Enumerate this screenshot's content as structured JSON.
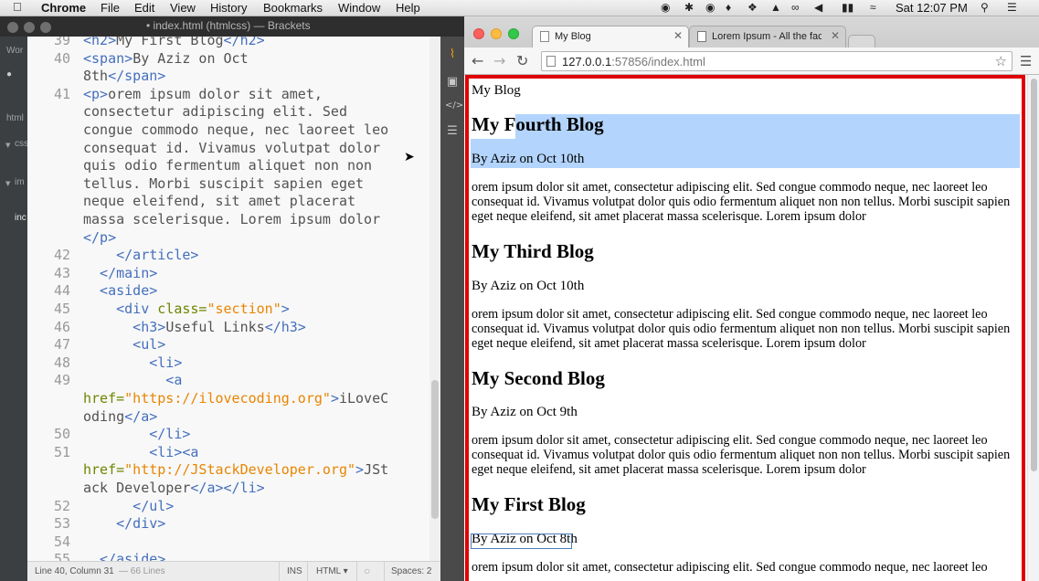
{
  "menubar": {
    "app": "Chrome",
    "items": [
      "File",
      "Edit",
      "View",
      "History",
      "Bookmarks",
      "Window",
      "Help"
    ],
    "clock": "Sat 12:07 PM",
    "icons": [
      "record-icon",
      "extension-icon",
      "chat-icon",
      "bell-icon",
      "dropbox-icon",
      "drive-icon",
      "creative-cloud-icon",
      "volume-icon",
      "battery-icon",
      "wifi-icon",
      "spotlight-icon",
      "notification-list-icon"
    ]
  },
  "brackets": {
    "title": "• index.html (htmlcss) — Brackets",
    "sidebar_labels": [
      "Wor",
      "html",
      "css",
      "im",
      "inc"
    ],
    "code_lines": [
      {
        "ln": "39",
        "tokens": [
          [
            "tag",
            "<h2>"
          ],
          [
            "txt",
            "My First Blog"
          ],
          [
            "tag",
            "</h2>"
          ]
        ]
      },
      {
        "ln": "40",
        "tokens": [
          [
            "tag",
            "<span>"
          ],
          [
            "txt",
            "By Aziz on Oct"
          ]
        ]
      },
      {
        "ln": "",
        "tokens": [
          [
            "txt",
            "8th"
          ],
          [
            "tag",
            "</span>"
          ]
        ]
      },
      {
        "ln": "41",
        "tokens": [
          [
            "tag",
            "<p>"
          ],
          [
            "txt",
            "orem ipsum dolor sit amet,"
          ]
        ]
      },
      {
        "ln": "",
        "tokens": [
          [
            "txt",
            "consectetur adipiscing elit. Sed"
          ]
        ]
      },
      {
        "ln": "",
        "tokens": [
          [
            "txt",
            "congue commodo neque, nec laoreet leo"
          ]
        ]
      },
      {
        "ln": "",
        "tokens": [
          [
            "txt",
            "consequat id. Vivamus volutpat dolor"
          ]
        ]
      },
      {
        "ln": "",
        "tokens": [
          [
            "txt",
            "quis odio fermentum aliquet non non"
          ]
        ]
      },
      {
        "ln": "",
        "tokens": [
          [
            "txt",
            "tellus. Morbi suscipit sapien eget"
          ]
        ]
      },
      {
        "ln": "",
        "tokens": [
          [
            "txt",
            "neque eleifend, sit amet placerat"
          ]
        ]
      },
      {
        "ln": "",
        "tokens": [
          [
            "txt",
            "massa scelerisque. Lorem ipsum dolor"
          ]
        ]
      },
      {
        "ln": "",
        "tokens": [
          [
            "tag",
            "</p>"
          ]
        ]
      },
      {
        "ln": "42",
        "tokens": [
          [
            "tag",
            "    </article>"
          ]
        ]
      },
      {
        "ln": "43",
        "tokens": [
          [
            "tag",
            "  </main>"
          ]
        ]
      },
      {
        "ln": "44",
        "tokens": [
          [
            "tag",
            "  <aside>"
          ]
        ]
      },
      {
        "ln": "45",
        "tokens": [
          [
            "tag",
            "    <div "
          ],
          [
            "attr",
            "class="
          ],
          [
            "str",
            "\"section\""
          ],
          [
            "tag",
            ">"
          ]
        ]
      },
      {
        "ln": "46",
        "tokens": [
          [
            "tag",
            "      <h3>"
          ],
          [
            "txt",
            "Useful Links"
          ],
          [
            "tag",
            "</h3>"
          ]
        ]
      },
      {
        "ln": "47",
        "tokens": [
          [
            "tag",
            "      <ul>"
          ]
        ]
      },
      {
        "ln": "48",
        "tokens": [
          [
            "tag",
            "        <li>"
          ]
        ]
      },
      {
        "ln": "49",
        "tokens": [
          [
            "tag",
            "          <a"
          ]
        ]
      },
      {
        "ln": "",
        "tokens": [
          [
            "attr",
            "href="
          ],
          [
            "str",
            "\"https://ilovecoding.org\""
          ],
          [
            "tag",
            ">"
          ],
          [
            "txt",
            "iLoveC"
          ]
        ]
      },
      {
        "ln": "",
        "tokens": [
          [
            "txt",
            "oding"
          ],
          [
            "tag",
            "</a>"
          ]
        ]
      },
      {
        "ln": "50",
        "tokens": [
          [
            "tag",
            "        </li>"
          ]
        ]
      },
      {
        "ln": "51",
        "tokens": [
          [
            "tag",
            "        <li><a"
          ]
        ]
      },
      {
        "ln": "",
        "tokens": [
          [
            "attr",
            "href="
          ],
          [
            "str",
            "\"http://JStackDeveloper.org\""
          ],
          [
            "tag",
            ">"
          ],
          [
            "txt",
            "JSt"
          ]
        ]
      },
      {
        "ln": "",
        "tokens": [
          [
            "txt",
            "ack Developer"
          ],
          [
            "tag",
            "</a></li>"
          ]
        ]
      },
      {
        "ln": "52",
        "tokens": [
          [
            "tag",
            "      </ul>"
          ]
        ]
      },
      {
        "ln": "53",
        "tokens": [
          [
            "tag",
            "    </div>"
          ]
        ]
      },
      {
        "ln": "54",
        "tokens": []
      },
      {
        "ln": "55",
        "tokens": [
          [
            "tag",
            "  </aside>"
          ]
        ]
      }
    ],
    "status": {
      "position": "Line 40, Column 31",
      "lines": "— 66 Lines",
      "mode": "INS",
      "language": "HTML ▾",
      "spaces": "Spaces: 2"
    }
  },
  "chrome": {
    "tabs": [
      {
        "label": "My Blog",
        "active": true
      },
      {
        "label": "Lorem Ipsum - All the facts",
        "active": false
      }
    ],
    "url_host": "127.0.0.1",
    "url_rest": ":57856/index.html",
    "page": {
      "site_title": "My Blog",
      "posts": [
        {
          "title": "My Fourth Blog",
          "byline": "By Aziz on Oct 10th",
          "body": "orem ipsum dolor sit amet, consectetur adipiscing elit. Sed congue commodo neque, nec laoreet leo consequat id. Vivamus volutpat dolor quis odio fermentum aliquet non non tellus. Morbi suscipit sapien eget neque eleifend, sit amet placerat massa scelerisque. Lorem ipsum dolor"
        },
        {
          "title": "My Third Blog",
          "byline": "By Aziz on Oct 10th",
          "body": "orem ipsum dolor sit amet, consectetur adipiscing elit. Sed congue commodo neque, nec laoreet leo consequat id. Vivamus volutpat dolor quis odio fermentum aliquet non non tellus. Morbi suscipit sapien eget neque eleifend, sit amet placerat massa scelerisque. Lorem ipsum dolor"
        },
        {
          "title": "My Second Blog",
          "byline": "By Aziz on Oct 9th",
          "body": "orem ipsum dolor sit amet, consectetur adipiscing elit. Sed congue commodo neque, nec laoreet leo consequat id. Vivamus volutpat dolor quis odio fermentum aliquet non non tellus. Morbi suscipit sapien eget neque eleifend, sit amet placerat massa scelerisque. Lorem ipsum dolor"
        },
        {
          "title": "My First Blog",
          "byline": "By Aziz on Oct 8th",
          "body": "orem ipsum dolor sit amet, consectetur adipiscing elit. Sed congue commodo neque, nec laoreet leo"
        }
      ]
    }
  }
}
